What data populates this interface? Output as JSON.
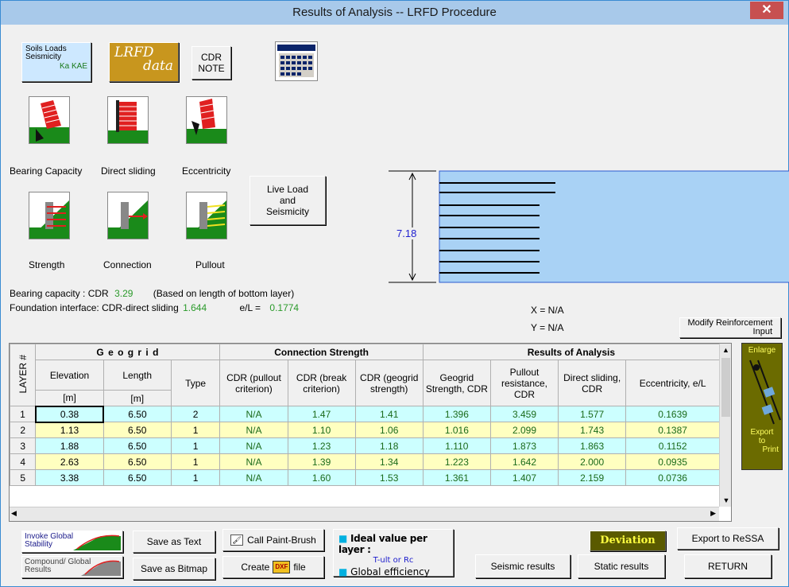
{
  "window": {
    "title": "Results of Analysis -- LRFD Procedure",
    "close_glyph": "✕"
  },
  "top_buttons": {
    "soils": {
      "line1": "Soils Loads",
      "line2": "Seismicity",
      "line3": "Ka  KAE"
    },
    "lrfd": {
      "line1": "LRFD",
      "line2": "data"
    },
    "cdr_note": {
      "line1": "CDR",
      "line2": "NOTE"
    }
  },
  "icons": {
    "bearing_capacity": "Bearing Capacity",
    "direct_sliding": "Direct sliding",
    "eccentricity": "Eccentricity",
    "strength": "Strength",
    "connection": "Connection",
    "pullout": "Pullout"
  },
  "live_load_button": {
    "line1": "Live Load",
    "line2": "and",
    "line3": "Seismicity"
  },
  "diagram": {
    "height_label": "7.18",
    "x_readout": "X = N/A",
    "y_readout": "Y = N/A"
  },
  "summary": {
    "bearing_label": "Bearing capacity :  CDR",
    "bearing_value": "3.29",
    "bearing_note": "(Based on length of bottom layer)",
    "foundation_label": "Foundation interface:  CDR-direct sliding",
    "foundation_value": "1.644",
    "el_label": "e/L =",
    "el_value": "0.1774"
  },
  "modify_button": {
    "line1": "Modify Reinforcement",
    "line2": "Input"
  },
  "table": {
    "group_headers": {
      "layer": "LAYER #",
      "geogrid": "G e o g r i d",
      "connection": "Connection Strength",
      "results": "Results of Analysis"
    },
    "col_headers": {
      "elevation": "Elevation",
      "elevation_unit": "[m]",
      "length": "Length",
      "length_unit": "[m]",
      "type": "Type",
      "cdr_pullout": "CDR (pullout criterion)",
      "cdr_break": "CDR (break criterion)",
      "cdr_geogrid": "CDR (geogrid strength)",
      "geogrid_strength": "Geogrid Strength, CDR",
      "pullout_resistance": "Pullout resistance, CDR",
      "direct_sliding": "Direct sliding, CDR",
      "eccentricity": "Eccentricity, e/L"
    },
    "rows": [
      {
        "layer": "1",
        "elevation": "0.38",
        "length": "6.50",
        "type": "2",
        "cdr_pullout": "N/A",
        "cdr_break": "1.47",
        "cdr_geogrid": "1.41",
        "geo_strength": "1.396",
        "pullout": "3.459",
        "sliding": "1.577",
        "ecc": "0.1639"
      },
      {
        "layer": "2",
        "elevation": "1.13",
        "length": "6.50",
        "type": "1",
        "cdr_pullout": "N/A",
        "cdr_break": "1.10",
        "cdr_geogrid": "1.06",
        "geo_strength": "1.016",
        "pullout": "2.099",
        "sliding": "1.743",
        "ecc": "0.1387"
      },
      {
        "layer": "3",
        "elevation": "1.88",
        "length": "6.50",
        "type": "1",
        "cdr_pullout": "N/A",
        "cdr_break": "1.23",
        "cdr_geogrid": "1.18",
        "geo_strength": "1.110",
        "pullout": "1.873",
        "sliding": "1.863",
        "ecc": "0.1152"
      },
      {
        "layer": "4",
        "elevation": "2.63",
        "length": "6.50",
        "type": "1",
        "cdr_pullout": "N/A",
        "cdr_break": "1.39",
        "cdr_geogrid": "1.34",
        "geo_strength": "1.223",
        "pullout": "1.642",
        "sliding": "2.000",
        "ecc": "0.0935"
      },
      {
        "layer": "5",
        "elevation": "3.38",
        "length": "6.50",
        "type": "1",
        "cdr_pullout": "N/A",
        "cdr_break": "1.60",
        "cdr_geogrid": "1.53",
        "geo_strength": "1.361",
        "pullout": "1.407",
        "sliding": "2.159",
        "ecc": "0.0736"
      }
    ]
  },
  "side_panel": {
    "enlarge": "Enlarge",
    "export": "Export",
    "to": "to",
    "print": "Print"
  },
  "bottom": {
    "invoke_global": {
      "line1": "Invoke Global",
      "line2": "Stability"
    },
    "compound_global": {
      "line1": "Compound/ Global",
      "line2": "Results"
    },
    "save_text": "Save as Text",
    "save_bitmap": "Save as Bitmap",
    "call_paint": "Call Paint-Brush",
    "create_dxf_pre": "Create",
    "create_dxf_icon": "DXF",
    "create_dxf_post": "file",
    "ideal": {
      "line1": "Ideal value per layer :",
      "line2": "T-ult  or  Rc",
      "line3": "Global  efficiency"
    },
    "deviation": "Deviation",
    "export_ressa": "Export to ReSSA",
    "seismic_results": "Seismic results",
    "static_results": "Static results",
    "return": "RETURN"
  }
}
